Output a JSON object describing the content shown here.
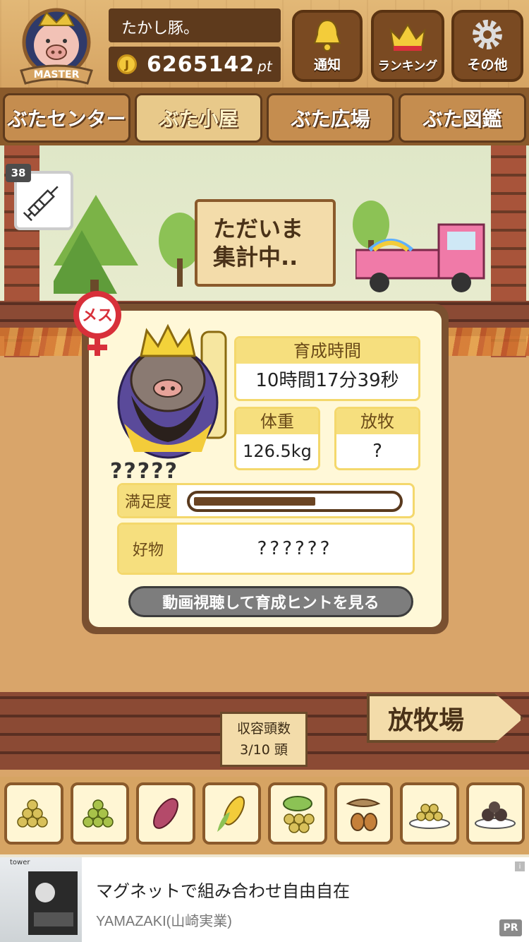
{
  "header": {
    "user_name": "たかし豚。",
    "points": "6265142",
    "points_unit": "pt",
    "coin_symbol": "J",
    "rank_badge": "MASTER",
    "buttons": [
      {
        "label": "通知",
        "icon": "bell-icon"
      },
      {
        "label": "ランキング",
        "icon": "crown-icon"
      },
      {
        "label": "その他",
        "icon": "gear-icon"
      }
    ]
  },
  "tabs": [
    {
      "label": "ぶたセンター"
    },
    {
      "label": "ぶた小屋"
    },
    {
      "label": "ぶた広場"
    },
    {
      "label": "ぶた図鑑"
    }
  ],
  "scene": {
    "item_count": "38",
    "sign_line1": "ただいま",
    "sign_line2": "集計中..",
    "capacity_label": "収容頭数",
    "capacity_value": "3/10 頭",
    "pasture_label": "放牧場"
  },
  "pig_info": {
    "gender_label": "メス",
    "name": "?????",
    "raise_time_label": "育成時間",
    "raise_time_value": "10時間17分39秒",
    "weight_label": "体重",
    "weight_value": "126.5kg",
    "grazing_label": "放牧",
    "grazing_value": "?",
    "satisfaction_label": "満足度",
    "satisfaction_level": 0.6,
    "favorite_label": "好物",
    "favorite_value": "??????",
    "hint_button": "動画視聴して育成ヒントを見る"
  },
  "foods": [
    {
      "icon": "soybeans-icon"
    },
    {
      "icon": "peas-icon"
    },
    {
      "icon": "sweet-potato-icon"
    },
    {
      "icon": "corn-icon"
    },
    {
      "icon": "grapes-icon"
    },
    {
      "icon": "acorn-icon"
    },
    {
      "icon": "grain-plate-icon"
    },
    {
      "icon": "truffle-icon"
    }
  ],
  "ad": {
    "image_text": "tower",
    "title": "マグネットで組み合わせ自由自在",
    "advertiser": "YAMAZAKI(山崎実業)",
    "pr_label": "PR",
    "info_label": "i"
  },
  "colors": {
    "wood_dark": "#5e3a1c",
    "wood_light": "#e2b877",
    "panel_yellow": "#f6df7e",
    "gender_red": "#d8303a"
  }
}
